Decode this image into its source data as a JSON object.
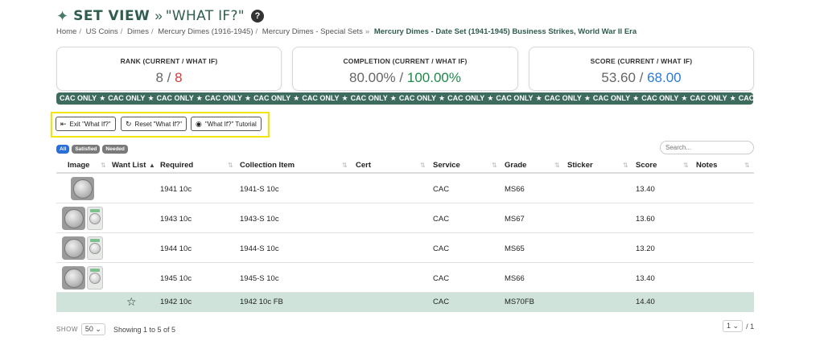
{
  "header": {
    "title": "SET VIEW",
    "separator": "»",
    "subtitle": "\"WHAT IF?\"",
    "help": "?"
  },
  "breadcrumb": {
    "items": [
      "Home",
      "US Coins",
      "Dimes",
      "Mercury Dimes (1916-1945)",
      "Mercury Dimes - Special Sets"
    ],
    "current": "Mercury Dimes - Date Set (1941-1945) Business Strikes, World War II Era"
  },
  "stats": {
    "rank": {
      "label": "RANK (CURRENT / WHAT IF)",
      "current": "8",
      "whatif": "8"
    },
    "completion": {
      "label": "COMPLETION (CURRENT / WHAT IF)",
      "current": "80.00%",
      "whatif": "100.00%"
    },
    "score": {
      "label": "SCORE (CURRENT / WHAT IF)",
      "current": "53.60",
      "whatif": "68.00"
    }
  },
  "banner": {
    "text": "CAC ONLY",
    "sep": "★",
    "tail": "CAC OI"
  },
  "whatif_buttons": {
    "exit": "Exit \"What If?\"",
    "reset": "Reset \"What If?\"",
    "tutorial": "\"What If?\" Tutorial"
  },
  "filters": {
    "all": "All",
    "satisfied": "Satisfied",
    "needed": "Needed"
  },
  "search": {
    "placeholder": "Search..."
  },
  "table": {
    "columns": {
      "image": "Image",
      "want_list": "Want List",
      "required": "Required",
      "collection_item": "Collection Item",
      "cert": "Cert",
      "service": "Service",
      "grade": "Grade",
      "sticker": "Sticker",
      "score": "Score",
      "notes": "Notes"
    },
    "rows": [
      {
        "required": "1941 10c",
        "item": "1941-S 10c",
        "cert": "",
        "service": "CAC",
        "grade": "MS66",
        "sticker": "",
        "score": "13.40",
        "notes": ""
      },
      {
        "required": "1943 10c",
        "item": "1943-S 10c",
        "cert": "",
        "service": "CAC",
        "grade": "MS67",
        "sticker": "",
        "score": "13.60",
        "notes": ""
      },
      {
        "required": "1944 10c",
        "item": "1944-S 10c",
        "cert": "",
        "service": "CAC",
        "grade": "MS65",
        "sticker": "",
        "score": "13.20",
        "notes": ""
      },
      {
        "required": "1945 10c",
        "item": "1945-S 10c",
        "cert": "",
        "service": "CAC",
        "grade": "MS66",
        "sticker": "",
        "score": "13.40",
        "notes": ""
      },
      {
        "required": "1942 10c",
        "item": "1942 10c FB",
        "cert": "",
        "service": "CAC",
        "grade": "MS70FB",
        "sticker": "",
        "score": "14.40",
        "notes": ""
      }
    ]
  },
  "footer": {
    "show_label": "SHOW",
    "page_size": "50",
    "showing": "Showing 1 to 5 of 5",
    "page": "1",
    "page_total": "/ 1"
  },
  "colors": {
    "brand": "#2f5d50",
    "banner": "#3d6b5d",
    "highlight_row": "#cfe3db",
    "whatif_rank": "#d23b3b",
    "whatif_completion": "#1e8a4a",
    "whatif_score": "#2a7ad6",
    "callout": "#f2e600"
  }
}
